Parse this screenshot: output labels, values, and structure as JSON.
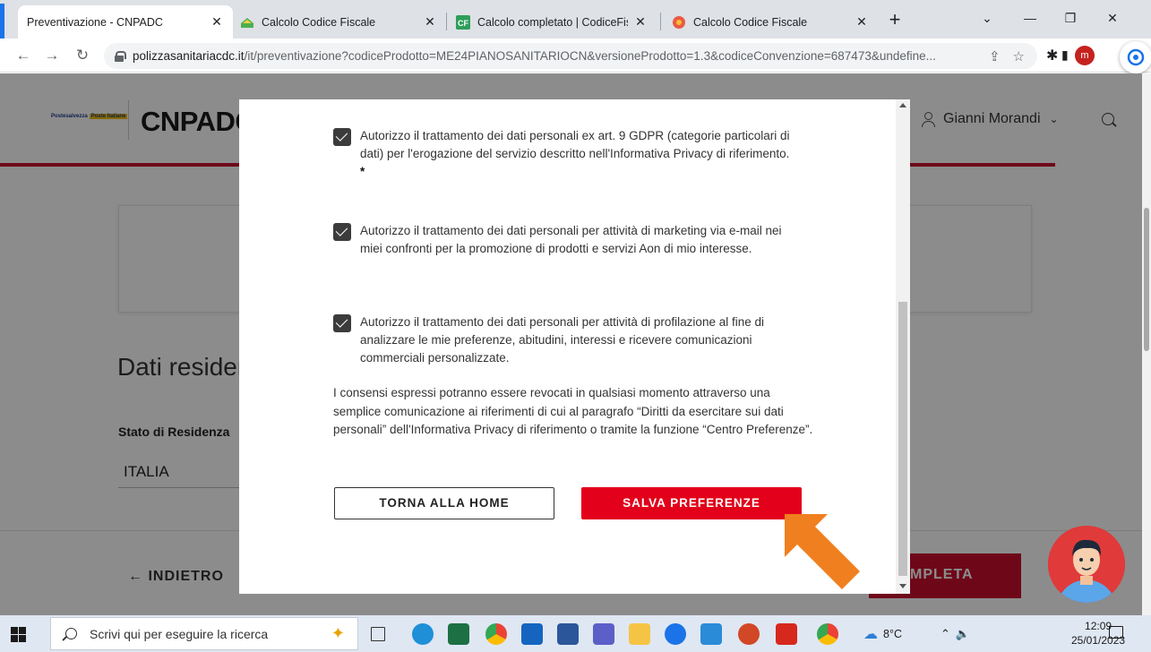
{
  "browser": {
    "tabs": [
      {
        "title": "Preventivazione - CNPADC",
        "active": true
      },
      {
        "title": "Calcolo Codice Fiscale",
        "active": false
      },
      {
        "title": "Calcolo completato | CodiceFiscale",
        "active": false
      },
      {
        "title": "Calcolo Codice Fiscale",
        "active": false
      }
    ],
    "new_tab": "+",
    "url_host": "polizzasanitariacdc.it",
    "url_path": "/it/preventivazione?codiceProdotto=ME24PIANOSANITARIOCN&versioneProdotto=1.3&codiceConvenzione=687473&undefine...",
    "profile_initial": "m"
  },
  "site": {
    "logo_small_a": "Postesalvezza",
    "logo_small_b": "Poste Italiane",
    "logo_main": "CNPADC",
    "user_name": "Gianni Morandi",
    "section_title": "Dati residenza",
    "field_label": "Stato di Residenza",
    "field_value": "ITALIA",
    "back_label": "INDIETRO",
    "complete_label": "COMPLETA"
  },
  "modal": {
    "consent_1": "Autorizzo il trattamento dei dati personali ex art. 9 GDPR (categorie particolari di dati) per l'erogazione del servizio descritto nell'Informativa Privacy di riferimento.",
    "consent_1_required": "*",
    "consent_2": "Autorizzo il trattamento dei dati personali per attività di marketing via e-mail nei miei confronti per la promozione di prodotti e servizi Aon di mio interesse.",
    "consent_3": "Autorizzo il trattamento dei dati personali per attività di profilazione al fine di analizzare le mie preferenze, abitudini, interessi e ricevere comunicazioni commerciali personalizzate.",
    "note": "I consensi espressi potranno essere revocati in qualsiasi momento attraverso una semplice comunicazione ai riferimenti di cui al paragrafo “Diritti da esercitare sui dati personali” dell'Informativa Privacy di riferimento o tramite la funzione “Centro Preferenze”.",
    "btn_home": "TORNA ALLA HOME",
    "btn_save": "SALVA PREFERENZE"
  },
  "taskbar": {
    "search_placeholder": "Scrivi qui per eseguire la ricerca",
    "weather": "8°C",
    "time": "12:09",
    "date": "25/01/2023"
  },
  "colors": {
    "brand_red": "#c8102e",
    "save_red": "#e2001a",
    "arrow_orange": "#f07f1f"
  }
}
